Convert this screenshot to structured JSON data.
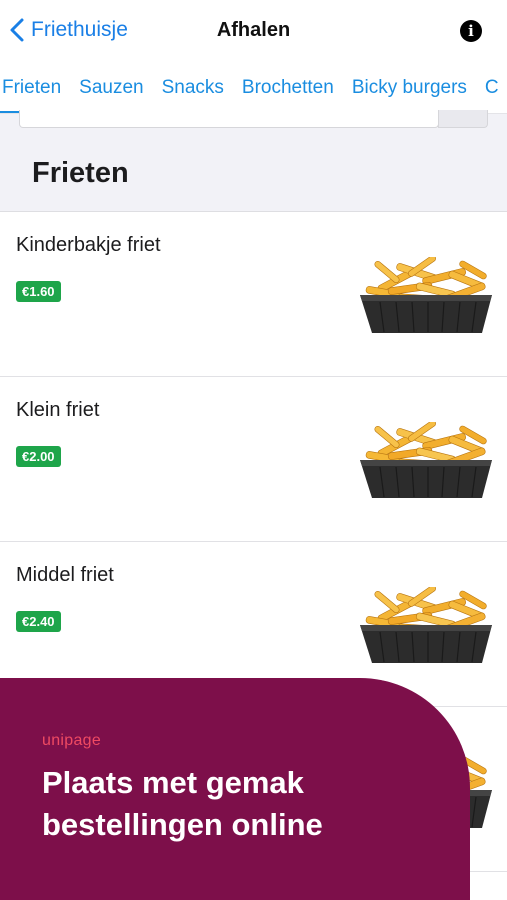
{
  "nav": {
    "back_label": "Friethuisje",
    "title": "Afhalen",
    "info_symbol": "i"
  },
  "tabs": [
    {
      "label": "Frieten",
      "active": true
    },
    {
      "label": "Sauzen",
      "active": false
    },
    {
      "label": "Snacks",
      "active": false
    },
    {
      "label": "Brochetten",
      "active": false
    },
    {
      "label": "Bicky burgers",
      "active": false
    },
    {
      "label": "C",
      "active": false
    }
  ],
  "section": {
    "title": "Frieten"
  },
  "items": [
    {
      "name": "Kinderbakje friet",
      "price": "€1.60"
    },
    {
      "name": "Klein friet",
      "price": "€2.00"
    },
    {
      "name": "Middel friet",
      "price": "€2.40"
    }
  ],
  "promo": {
    "logo": "unipage",
    "line1": "Plaats met gemak",
    "line2": "bestellingen online"
  },
  "colors": {
    "accent": "#1a8de0",
    "price_badge": "#1ea54a",
    "promo_bg": "#7d0f4a",
    "promo_logo": "#ef4a62"
  }
}
